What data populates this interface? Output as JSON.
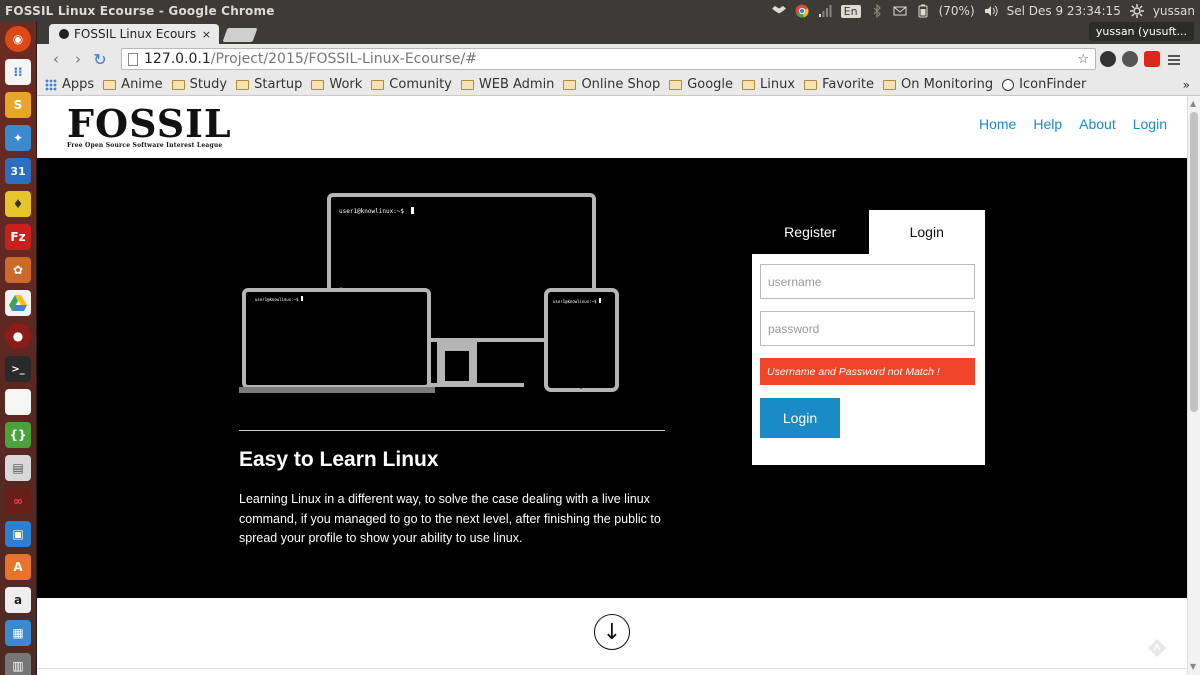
{
  "os": {
    "window_title": "FOSSIL Linux Ecourse - Google Chrome",
    "battery": "(70%)",
    "lang": "En",
    "clock": "Sel Des  9 23:34:15",
    "username": "yussan"
  },
  "browser": {
    "tab_title": "FOSSIL Linux Ecours",
    "tab_close": "×",
    "profile": "yussan (yusuft...",
    "url_host": "127.0.0.1",
    "url_path": "/Project/2015/FOSSIL-Linux-Ecourse/#",
    "bookmarks": [
      "Apps",
      "Anime",
      "Study",
      "Startup",
      "Work",
      "Comunity",
      "WEB Admin",
      "Online Shop",
      "Google",
      "Linux",
      "Favorite",
      "On Monitoring",
      "IconFinder"
    ],
    "bookmarks_more": "»"
  },
  "site": {
    "logo": "FOSSIL",
    "logo_sub": "Free Open Source Software Interest League",
    "nav": [
      "Home",
      "Help",
      "About",
      "Login"
    ],
    "terminal_prompt": "user1@knowlinux:~$",
    "hero_title": "Easy to Learn Linux",
    "hero_desc": "Learning Linux in a different way, to solve the case dealing with a live linux command, if you managed to go to the next level, after finishing the public to spread your profile to show your ability to use linux.",
    "login": {
      "tab_register": "Register",
      "tab_login": "Login",
      "username_placeholder": "username",
      "password_placeholder": "password",
      "error": "Username and Password not Match !",
      "button": "Login"
    },
    "down_arrow": "↓"
  },
  "colors": {
    "accent": "#1a8bc6",
    "error": "#f0452a",
    "hero_bg": "#000000"
  }
}
